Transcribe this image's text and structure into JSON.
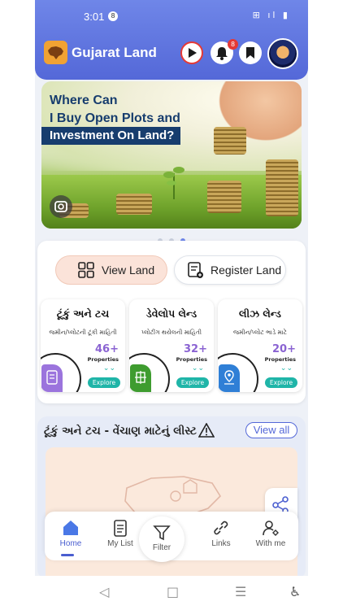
{
  "status_bar": {
    "time": "3:01",
    "notification_count": "8",
    "right_icons": "⊞ ıl ▮"
  },
  "header": {
    "title": "Gujarat Land",
    "notification_count": "8"
  },
  "banner": {
    "line1": "Where Can",
    "line2": "I Buy Open Plots and",
    "line3": "Investment On Land?"
  },
  "tabs": {
    "view_label": "View Land",
    "register_label": "Register Land"
  },
  "properties": [
    {
      "title": "ટૂંકું અને ટચ",
      "subtitle": "જમીન/પ્લોટની ટૂંકી માહિતી",
      "count": "46+",
      "count_label": "Properties",
      "button": "Explore",
      "accent": "#8a63d2",
      "count_color": "#8a63d2"
    },
    {
      "title": "ડેવેલોપ લેન્ડ",
      "subtitle": "પ્લોટીંગ થયેલની માહિતી",
      "count": "32+",
      "count_label": "Properties",
      "button": "Explore",
      "accent": "#3e9c2f",
      "count_color": "#8a63d2"
    },
    {
      "title": "લીઝ લેન્ડ",
      "subtitle": "જમીન/પ્લોટ ભાડે માટે",
      "count": "20+",
      "count_label": "Properties",
      "button": "Explore",
      "accent": "#2f7fd6",
      "count_color": "#8a63d2"
    }
  ],
  "list_section": {
    "title": "ટૂંકું અને ટચ - વેંચાણ માટેનું લીસ્ટ",
    "view_all": "View all"
  },
  "bottom_nav": {
    "home": "Home",
    "my_list": "My List",
    "filter": "Filter",
    "links": "Links",
    "with_me": "With me"
  },
  "colors": {
    "header": "#5f76e0",
    "accent": "#4a5ed0",
    "explore": "#1fb5a8"
  }
}
